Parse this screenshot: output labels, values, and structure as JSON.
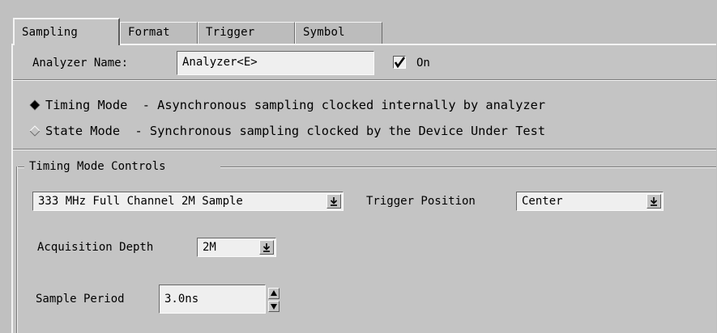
{
  "tabs": [
    {
      "label": "Sampling",
      "active": true
    },
    {
      "label": "Format",
      "active": false
    },
    {
      "label": "Trigger",
      "active": false
    },
    {
      "label": "Symbol",
      "active": false
    }
  ],
  "analyzer": {
    "name_label": "Analyzer Name:",
    "name_value": "Analyzer<E>",
    "on_label": "On",
    "on_checked": true
  },
  "modes": [
    {
      "name": "Timing Mode",
      "description": "Timing Mode  - Asynchronous sampling clocked internally by analyzer",
      "selected": true
    },
    {
      "name": "State Mode",
      "description": "State Mode  - Synchronous sampling clocked by the Device Under Test",
      "selected": false
    }
  ],
  "timing_controls": {
    "group_title": "Timing Mode Controls",
    "sample_mode_value": "333 MHz Full Channel 2M Sample",
    "trigger_position_label": "Trigger Position",
    "trigger_position_value": "Center",
    "acquisition_depth_label": "Acquisition Depth",
    "acquisition_depth_value": "2M",
    "sample_period_label": "Sample Period",
    "sample_period_value": "3.0ns"
  },
  "icons": {
    "dropdown": "dropdown-arrow-icon",
    "spin_up": "spin-up-icon",
    "spin_down": "spin-down-icon",
    "checkmark": "checkmark-icon",
    "radio": "radio-diamond-icon"
  }
}
